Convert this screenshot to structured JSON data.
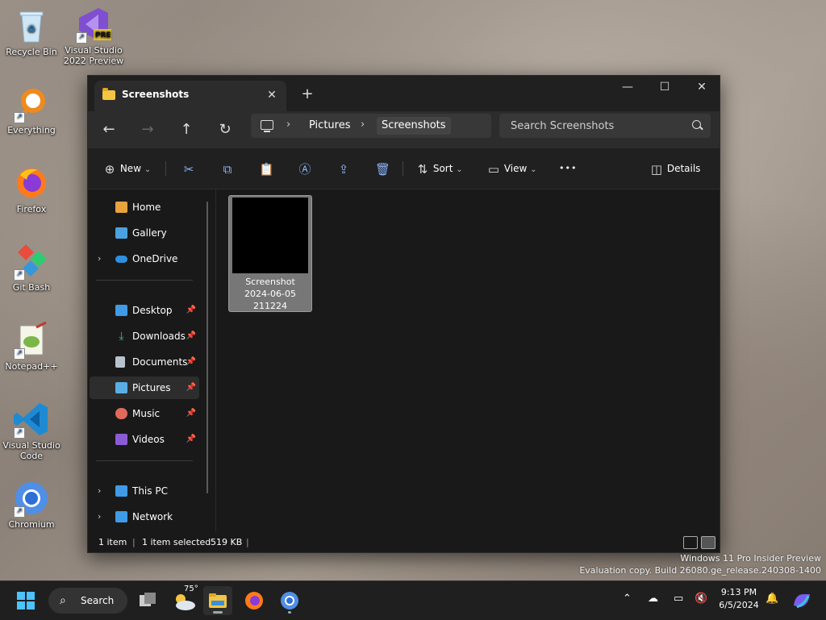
{
  "desktop": {
    "icons": [
      {
        "label": "Recycle Bin"
      },
      {
        "label": "Visual Studio 2022 Preview",
        "badge": "PRE"
      },
      {
        "label": "Everything"
      },
      {
        "label": "Firefox"
      },
      {
        "label": "Git Bash"
      },
      {
        "label": "Notepad++"
      },
      {
        "label": "Visual Studio Code"
      },
      {
        "label": "Chromium"
      }
    ],
    "watermark": {
      "line1": "Windows 11 Pro Insider Preview",
      "line2": "Evaluation copy. Build 26080.ge_release.240308-1400"
    }
  },
  "window": {
    "tab_title": "Screenshots",
    "close_tab": "✕",
    "new_tab": "+",
    "minimize": "—",
    "maximize": "☐",
    "close": "✕"
  },
  "nav": {
    "back": "←",
    "forward": "→",
    "up": "↑",
    "refresh": "↻",
    "breadcrumb": [
      "Pictures",
      "Screenshots"
    ],
    "chevron": "›",
    "search_placeholder": "Search Screenshots"
  },
  "toolbar": {
    "new_label": "New",
    "sort_label": "Sort",
    "view_label": "View",
    "more": "•••",
    "details_label": "Details",
    "caret": "⌄"
  },
  "sidebar": {
    "items": [
      {
        "label": "Home",
        "color": "#e8a33d"
      },
      {
        "label": "Gallery",
        "color": "#4aa3e0"
      },
      {
        "label": "OneDrive",
        "color": "#2f8fe0",
        "expand": "›"
      },
      {
        "label": "Desktop",
        "color": "#3f9be6",
        "pin": "📌"
      },
      {
        "label": "Downloads",
        "color": "#3ec07a",
        "pin": "📌"
      },
      {
        "label": "Documents",
        "color": "#b9c2cc",
        "pin": "📌"
      },
      {
        "label": "Pictures",
        "color": "#5aaee6",
        "pin": "📌",
        "selected": true
      },
      {
        "label": "Music",
        "color": "#e06a5a",
        "pin": "📌"
      },
      {
        "label": "Videos",
        "color": "#8b5bd6",
        "pin": "📌"
      },
      {
        "label": "This PC",
        "color": "#3f9be6",
        "expand": "›"
      },
      {
        "label": "Network",
        "color": "#3f9be6",
        "expand": "›"
      }
    ]
  },
  "content": {
    "files": [
      {
        "name_line1": "Screenshot",
        "name_line2": "2024-06-05",
        "name_line3": "211224"
      }
    ]
  },
  "status": {
    "count": "1 item",
    "selected": "1 item selected",
    "size": "519 KB",
    "sep": "|"
  },
  "taskbar": {
    "search_label": "Search",
    "weather_temp": "75°",
    "time": "9:13 PM",
    "date": "6/5/2024"
  },
  "colors": {
    "accent": "#8ab4f8",
    "window_bg": "#191919",
    "taskbar_bg": "#1f1f1f"
  }
}
